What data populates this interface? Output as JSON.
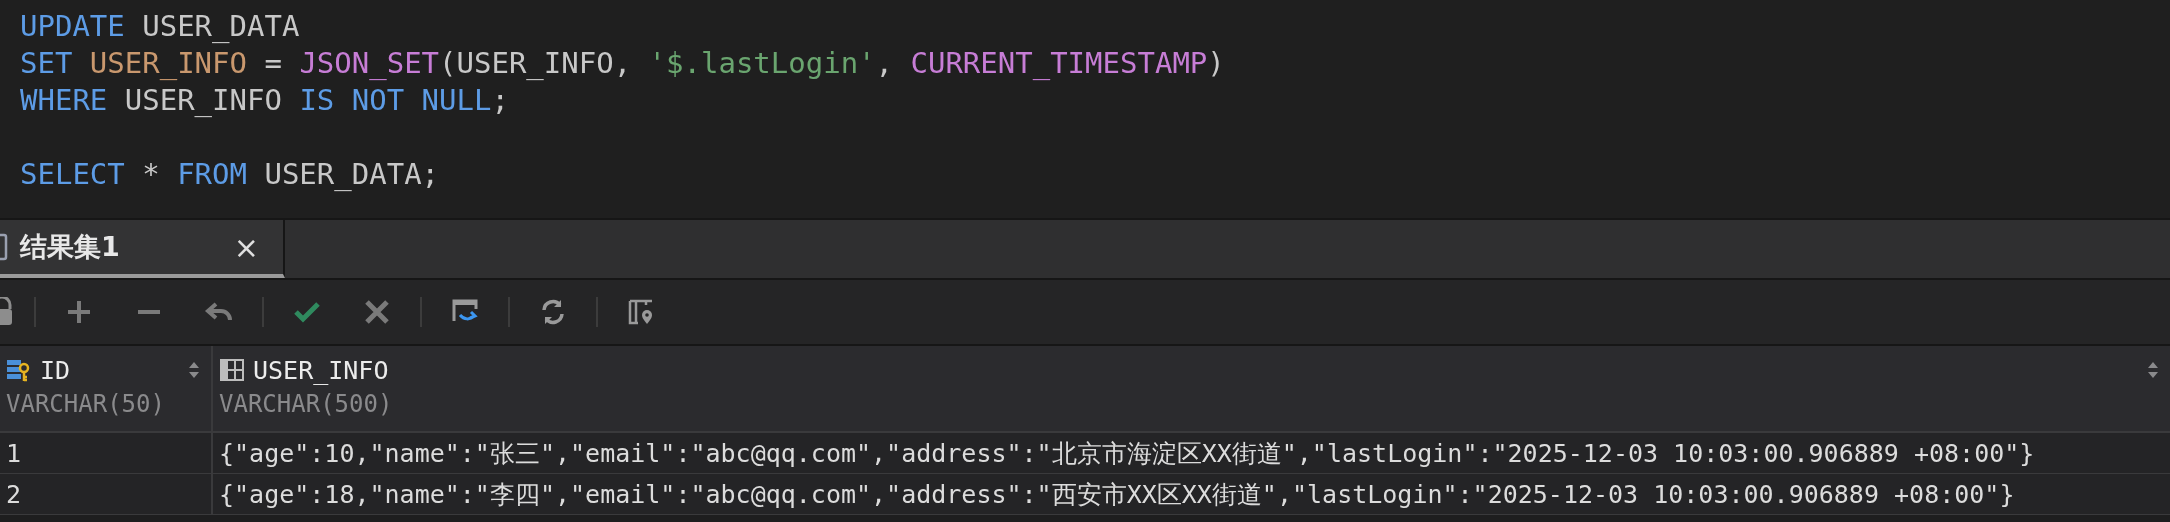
{
  "editor": {
    "lines": [
      {
        "kind": "code",
        "tokens": [
          {
            "text": "UPDATE ",
            "kind": "keyword"
          },
          {
            "text": "USER_DATA",
            "kind": "plain"
          }
        ]
      },
      {
        "kind": "code",
        "tokens": [
          {
            "text": "SET ",
            "kind": "keyword"
          },
          {
            "text": "USER_INFO",
            "kind": "column"
          },
          {
            "text": " = ",
            "kind": "plain"
          },
          {
            "text": "JSON_SET",
            "kind": "function"
          },
          {
            "text": "(USER_INFO, ",
            "kind": "plain"
          },
          {
            "text": "'$.lastLogin'",
            "kind": "string"
          },
          {
            "text": ", ",
            "kind": "plain"
          },
          {
            "text": "CURRENT_TIMESTAMP",
            "kind": "function"
          },
          {
            "text": ")",
            "kind": "plain"
          }
        ]
      },
      {
        "kind": "code",
        "tokens": [
          {
            "text": "WHERE ",
            "kind": "keyword"
          },
          {
            "text": "USER_INFO ",
            "kind": "plain"
          },
          {
            "text": "IS NOT NULL",
            "kind": "keyword"
          },
          {
            "text": ";",
            "kind": "plain"
          }
        ]
      },
      {
        "kind": "blank"
      },
      {
        "kind": "code",
        "tokens": [
          {
            "text": "SELECT ",
            "kind": "keyword"
          },
          {
            "text": "* ",
            "kind": "plain"
          },
          {
            "text": "FROM ",
            "kind": "keyword"
          },
          {
            "text": "USER_DATA;",
            "kind": "plain"
          }
        ]
      }
    ]
  },
  "tabs": [
    {
      "label": "结果集1",
      "selected": true,
      "close": "×"
    }
  ],
  "table": {
    "columns": [
      {
        "name": "ID",
        "type": "VARCHAR(50)",
        "kind": "key"
      },
      {
        "name": "USER_INFO",
        "type": "VARCHAR(500)",
        "kind": "json"
      }
    ],
    "rows": [
      [
        "1",
        "{\"age\":10,\"name\":\"张三\",\"email\":\"abc@qq.com\",\"address\":\"北京市海淀区XX街道\",\"lastLogin\":\"2025-12-03 10:03:00.906889 +08:00\"}"
      ],
      [
        "2",
        "{\"age\":18,\"name\":\"李四\",\"email\":\"abc@qq.com\",\"address\":\"西安市XX区XX街道\",\"lastLogin\":\"2025-12-03 10:03:00.906889 +08:00\"}"
      ]
    ]
  }
}
